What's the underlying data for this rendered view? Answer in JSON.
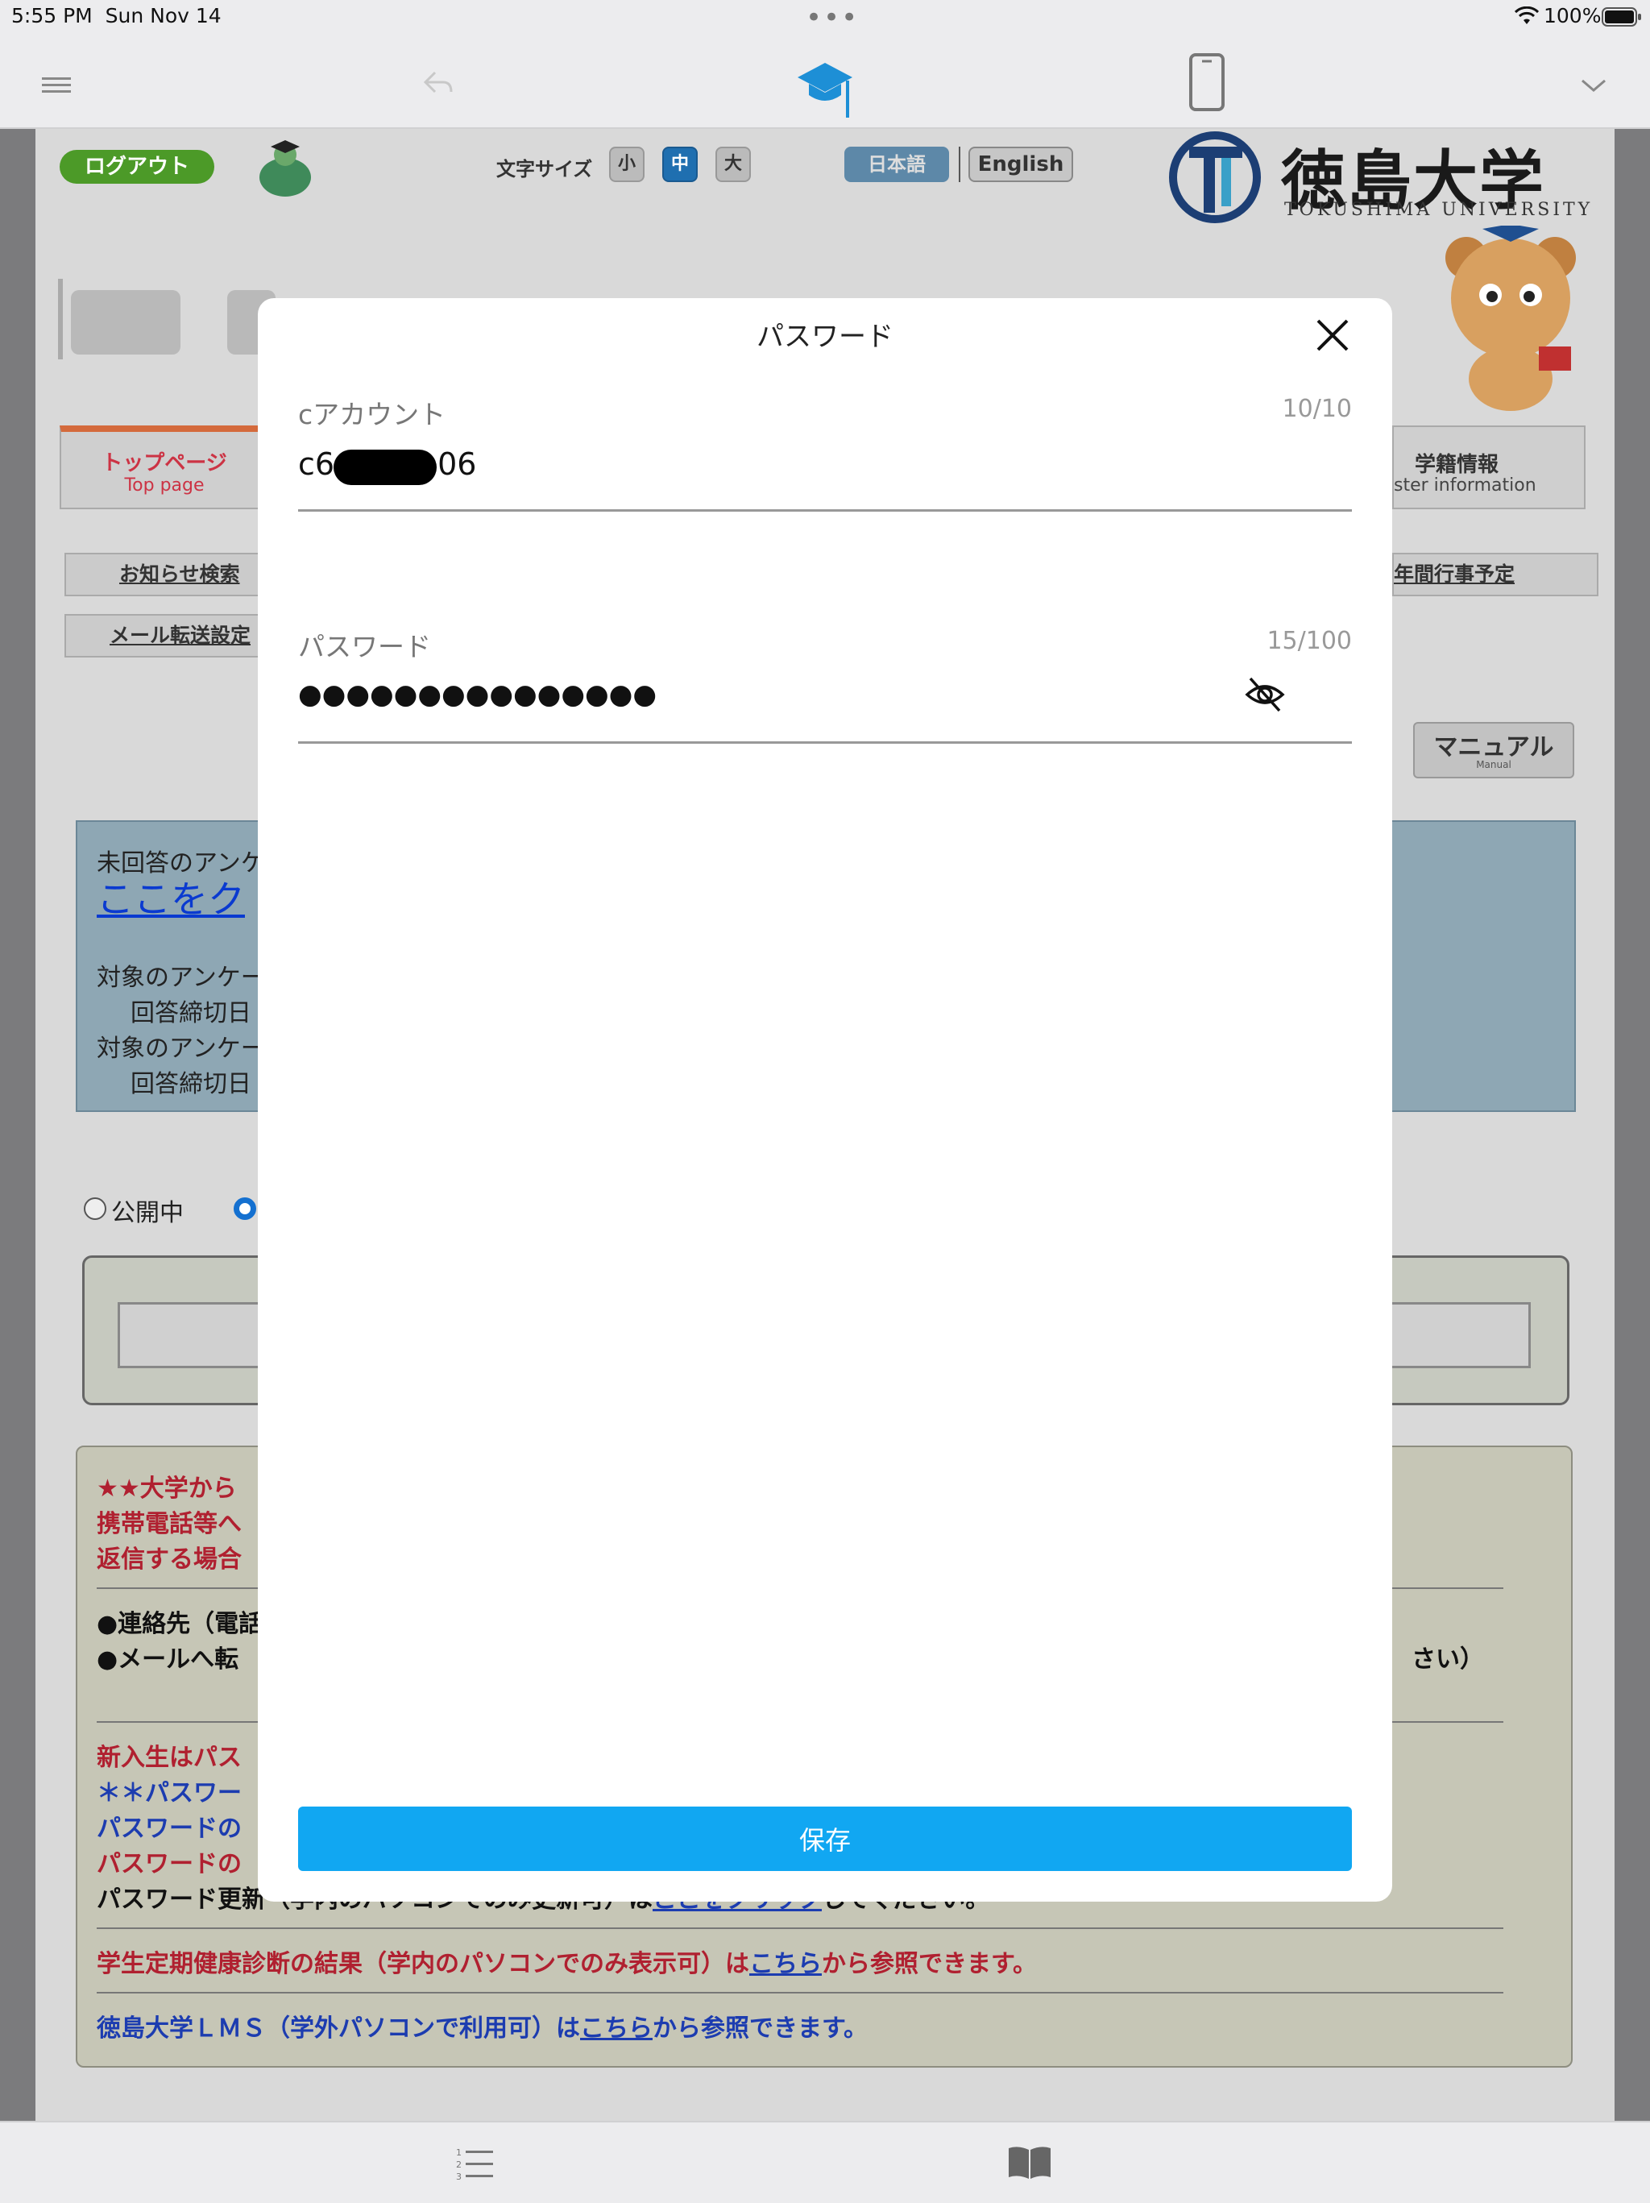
{
  "status_bar": {
    "time": "5:55 PM",
    "date": "Sun Nov 14",
    "dots": "•••",
    "battery": "100%"
  },
  "page": {
    "logout_label": "ログアウト",
    "font_size_label": "文字サイズ",
    "font_sizes": [
      "小",
      "中",
      "大"
    ],
    "lang_ja": "日本語",
    "lang_en": "English",
    "university_name": "徳島大学",
    "university_sub": "TOKUSHIMA UNIVERSITY",
    "tabs": {
      "top_ja": "トップページ",
      "top_en": "Top page",
      "gakuseki_ja": "学籍情報",
      "gakuseki_en": "ster information"
    },
    "links": {
      "notice_search": "お知らせ検索",
      "mail_forward": "メール転送設定",
      "annual_events": "年間行事予定"
    },
    "manual_label": "マニュアル",
    "manual_sub": "Manual",
    "survey": {
      "line1": "未回答のアンケ",
      "link": "ここをク",
      "target1": "対象のアンケー",
      "deadline1": "回答締切日",
      "target2": "対象のアンケー",
      "deadline2": "回答締切日"
    },
    "radio_public": "公開中",
    "notice": {
      "l1": "★★大学から",
      "l2": "携帯電話等へ",
      "l3": "返信する場合",
      "l4": "●連絡先（電話",
      "l5": "●メールへ転",
      "l5_end": "さい）",
      "l6": "新入生はパス",
      "l7": "＊＊パスワー",
      "l8": "パスワードの",
      "l9": "パスワードの",
      "l10_a": "パスワード更新（学内のパソコンでのみ更新可）は",
      "l10_link": "ここをクリック",
      "l10_b": "してください。",
      "l11_a": "学生定期健康診断の結果（学内のパソコンでのみ表示可）は",
      "l11_link": "こちら",
      "l11_b": "から参照できます。",
      "l12_a": "徳島大学ＬＭＳ（学外パソコンで利用可）は",
      "l12_link": "こちら",
      "l12_b": "から参照できます。"
    }
  },
  "modal": {
    "title": "パスワード",
    "account_label": "cアカウント",
    "account_count": "10/10",
    "account_prefix": "c6",
    "account_suffix": "06",
    "password_label": "パスワード",
    "password_count": "15/100",
    "password_masked": "●●●●●●●●●●●●●●●",
    "save_label": "保存"
  },
  "icons": {
    "toolbar": [
      "menu-icon",
      "back-icon",
      "graduation-cap-icon",
      "phone-icon",
      "chevron-down-icon"
    ],
    "bottom": [
      "numbered-list-icon",
      "book-icon"
    ],
    "modal": [
      "close-icon",
      "eye-slash-icon"
    ]
  },
  "colors": {
    "accent": "#11a7f2",
    "cap_blue": "#1d8fd6",
    "logout_green": "#4c9a28"
  }
}
